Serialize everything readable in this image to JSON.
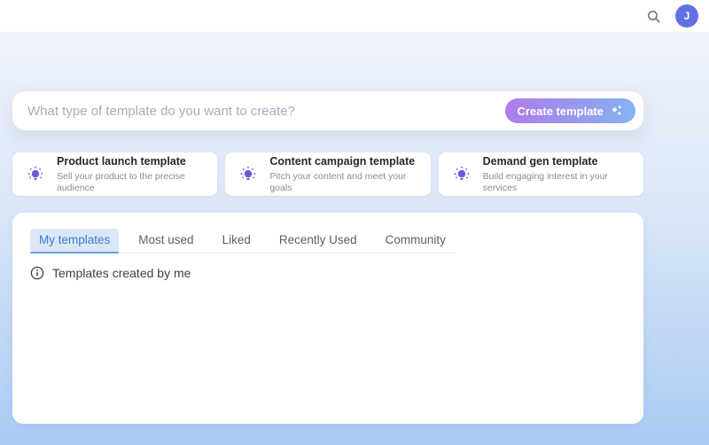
{
  "header": {
    "avatar_initial": "J"
  },
  "search": {
    "placeholder": "What type of template do you want to create?",
    "create_button_label": "Create template"
  },
  "suggestions": [
    {
      "title": "Product launch template",
      "description": "Sell your product to the precise audience"
    },
    {
      "title": "Content campaign template",
      "description": "Pitch your content and meet your goals"
    },
    {
      "title": "Demand gen template",
      "description": "Build engaging interest in your services"
    }
  ],
  "tabs": [
    {
      "label": "My templates",
      "active": true
    },
    {
      "label": "Most used",
      "active": false
    },
    {
      "label": "Liked",
      "active": false
    },
    {
      "label": "Recently Used",
      "active": false
    },
    {
      "label": "Community",
      "active": false
    }
  ],
  "templates_section": {
    "empty_message": "Templates created by me"
  },
  "colors": {
    "accent_gradient_start": "#b07de9",
    "accent_gradient_end": "#86b3f2",
    "avatar_background": "#6370e1",
    "active_tab_text": "#3d7cd7",
    "active_tab_background": "#dbe7f9",
    "bulb_icon": "#6a5ae0",
    "page_gradient_top": "#eff3fa",
    "page_gradient_bottom": "#a9cbf4"
  }
}
